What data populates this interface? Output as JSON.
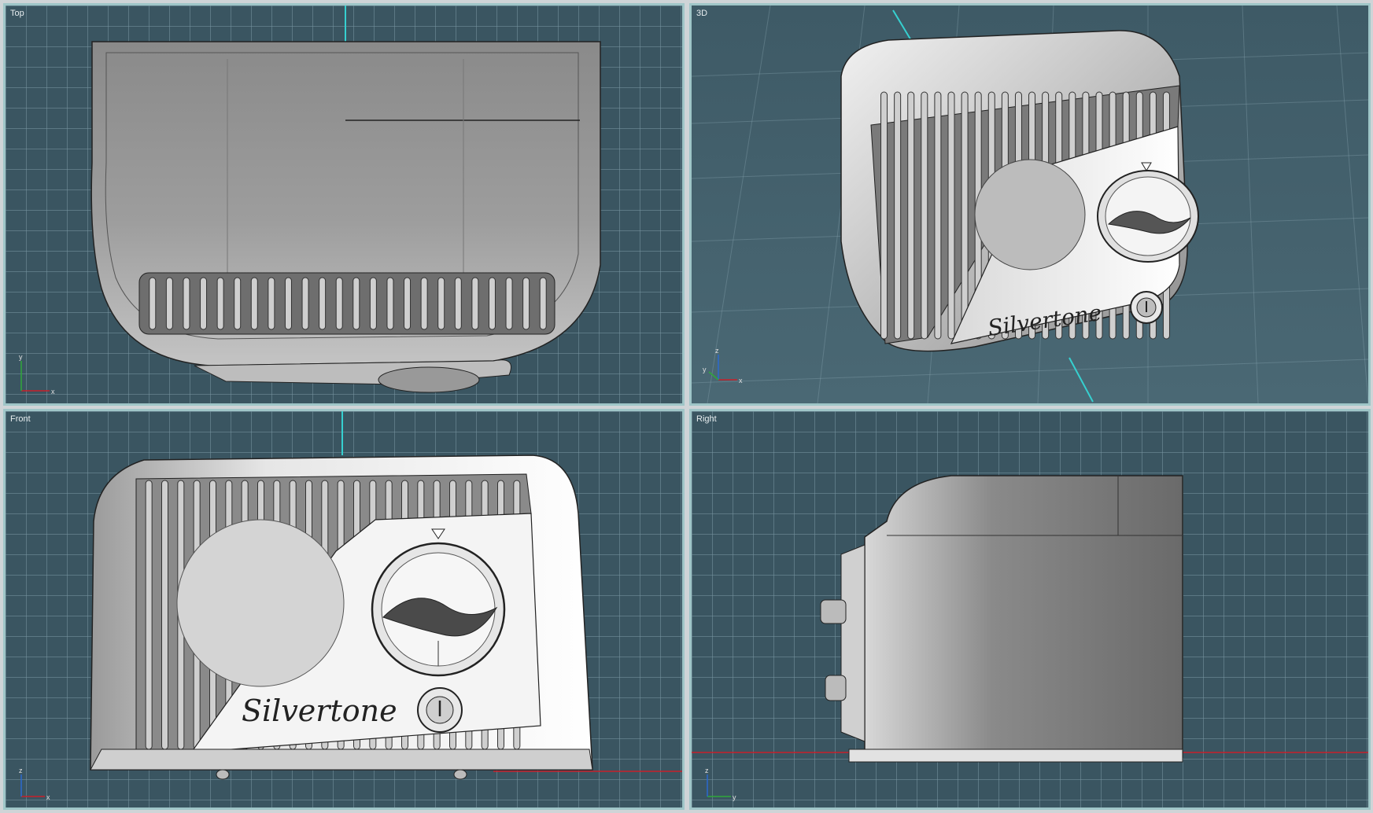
{
  "viewports": {
    "top": {
      "label": "Top"
    },
    "3d": {
      "label": "3D"
    },
    "front": {
      "label": "Front"
    },
    "right": {
      "label": "Right"
    }
  },
  "axes": {
    "top": {
      "h": "x",
      "v": "y"
    },
    "3d": {
      "h": "x",
      "v": "z",
      "d": "y"
    },
    "front": {
      "h": "x",
      "v": "z"
    },
    "right": {
      "h": "y",
      "v": "z"
    }
  },
  "model": {
    "brand_text": "Silvertone"
  },
  "colors": {
    "viewport_bg": "#3a5561",
    "grid_line": "#7896a0",
    "viewport_border": "#9fc6c8",
    "axis_x": "#c8202a",
    "axis_y": "#2fa83a",
    "axis_z": "#2a6ad0",
    "world_axis_cyan": "#36d0d0"
  }
}
